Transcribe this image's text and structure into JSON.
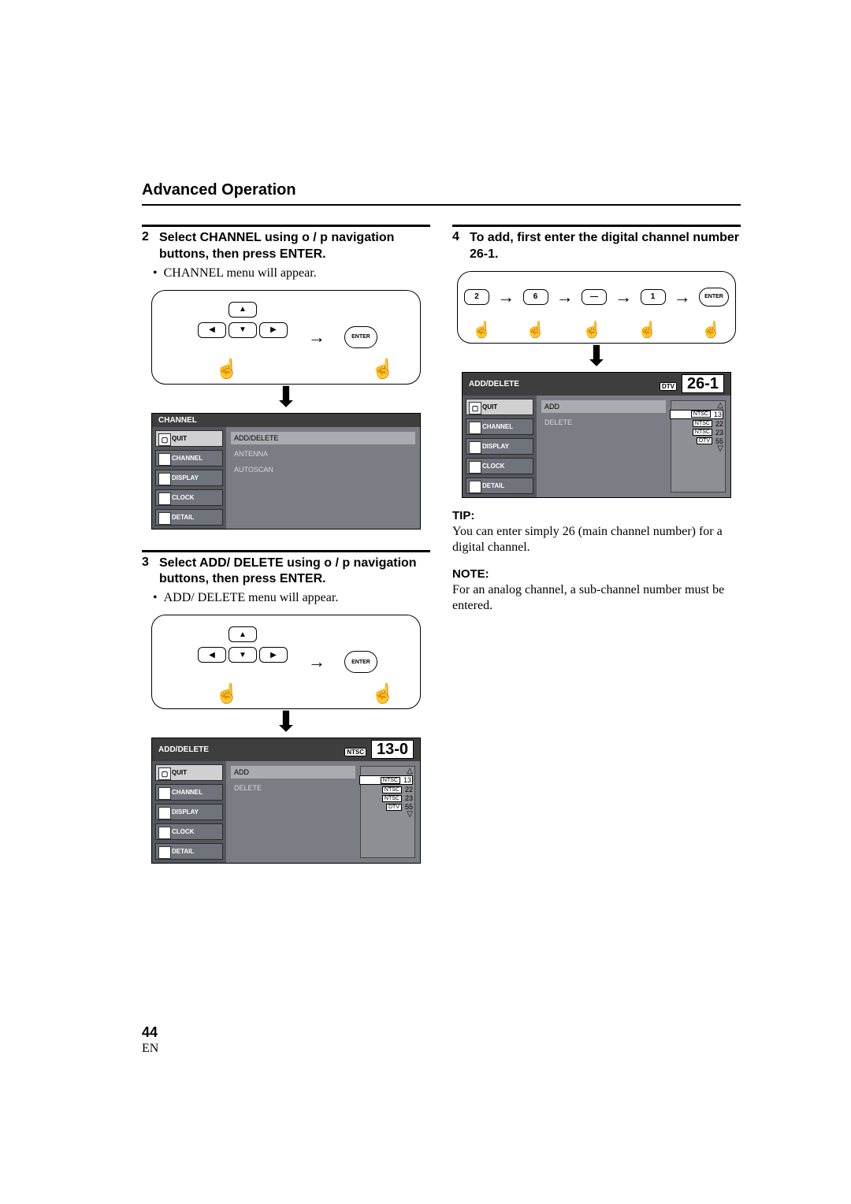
{
  "header": {
    "title": "Advanced Operation"
  },
  "left": {
    "step2": {
      "num": "2",
      "text": "Select CHANNEL using o / p  navigation buttons, then press ENTER."
    },
    "step2_sub": "CHANNEL menu will appear.",
    "enter": "ENTER",
    "channel_osd": {
      "title": "CHANNEL",
      "side": [
        "QUIT",
        "CHANNEL",
        "DISPLAY",
        "CLOCK",
        "DETAIL"
      ],
      "opts": [
        "ADD/DELETE",
        "ANTENNA",
        "AUTOSCAN"
      ]
    },
    "step3": {
      "num": "3",
      "text": "Select ADD/ DELETE using o / p navigation buttons, then press ENTER."
    },
    "step3_sub": "ADD/ DELETE menu will appear.",
    "add_osd": {
      "title": "ADD/DELETE",
      "chnum": "13-0",
      "badge": "NTSC",
      "side": [
        "QUIT",
        "CHANNEL",
        "DISPLAY",
        "CLOCK",
        "DETAIL"
      ],
      "opts": [
        "ADD",
        "DELETE"
      ],
      "list": [
        {
          "t": "NTSC",
          "n": "13",
          "sel": true
        },
        {
          "t": "NTSC",
          "n": "22"
        },
        {
          "t": "NTSC",
          "n": "23"
        },
        {
          "t": "DTV",
          "n": "55"
        }
      ]
    }
  },
  "right": {
    "step4": {
      "num": "4",
      "text": "To add, first enter the digital channel number 26-1."
    },
    "seq": [
      "2",
      "6",
      "—",
      "1"
    ],
    "enter": "ENTER",
    "add_osd": {
      "title": "ADD/DELETE",
      "chnum": "26-1",
      "badge": "DTV",
      "side": [
        "QUIT",
        "CHANNEL",
        "DISPLAY",
        "CLOCK",
        "DETAIL"
      ],
      "opts": [
        "ADD",
        "DELETE"
      ],
      "list": [
        {
          "t": "NTSC",
          "n": "13",
          "sel": true
        },
        {
          "t": "NTSC",
          "n": "22"
        },
        {
          "t": "NTSC",
          "n": "23"
        },
        {
          "t": "DTV",
          "n": "55"
        }
      ]
    },
    "tip_h": "TIP:",
    "tip_b": "You can enter simply 26 (main channel number) for a digital channel.",
    "note_h": "NOTE:",
    "note_b": "For an analog channel, a sub-channel number must be entered."
  },
  "footer": {
    "page": "44",
    "lang": "EN"
  }
}
